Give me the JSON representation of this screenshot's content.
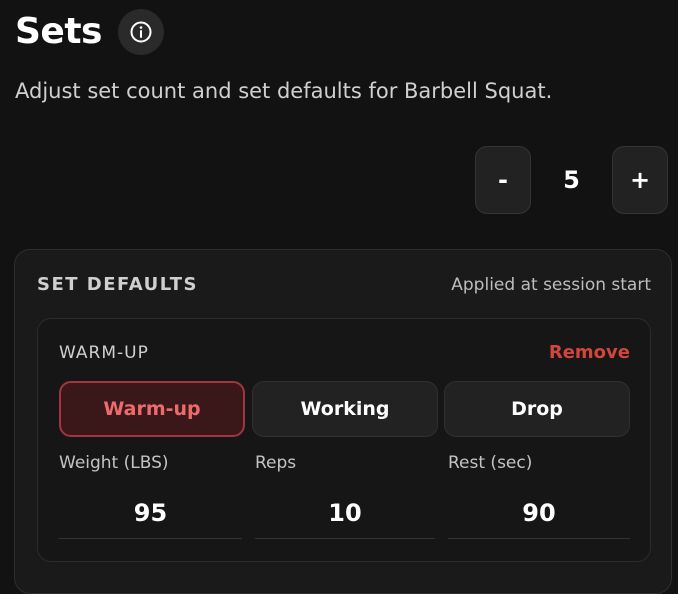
{
  "header": {
    "title": "Sets",
    "info_icon": "info-circle-icon"
  },
  "subtitle": "Adjust set count and set defaults for Barbell Squat.",
  "stepper": {
    "minus_label": "-",
    "value": "5",
    "plus_label": "+"
  },
  "set_defaults": {
    "title": "SET DEFAULTS",
    "note": "Applied at session start",
    "card": {
      "label": "WARM-UP",
      "remove_label": "Remove",
      "types": [
        {
          "label": "Warm-up",
          "selected": true
        },
        {
          "label": "Working",
          "selected": false
        },
        {
          "label": "Drop",
          "selected": false
        }
      ],
      "fields": [
        {
          "label": "Weight (LBS)",
          "value": "95"
        },
        {
          "label": "Reps",
          "value": "10"
        },
        {
          "label": "Rest (sec)",
          "value": "90"
        }
      ]
    }
  },
  "colors": {
    "background": "#121212",
    "accent_red": "#d2453d",
    "selected_text": "#ec6b6c",
    "selected_border": "#a3353b"
  }
}
